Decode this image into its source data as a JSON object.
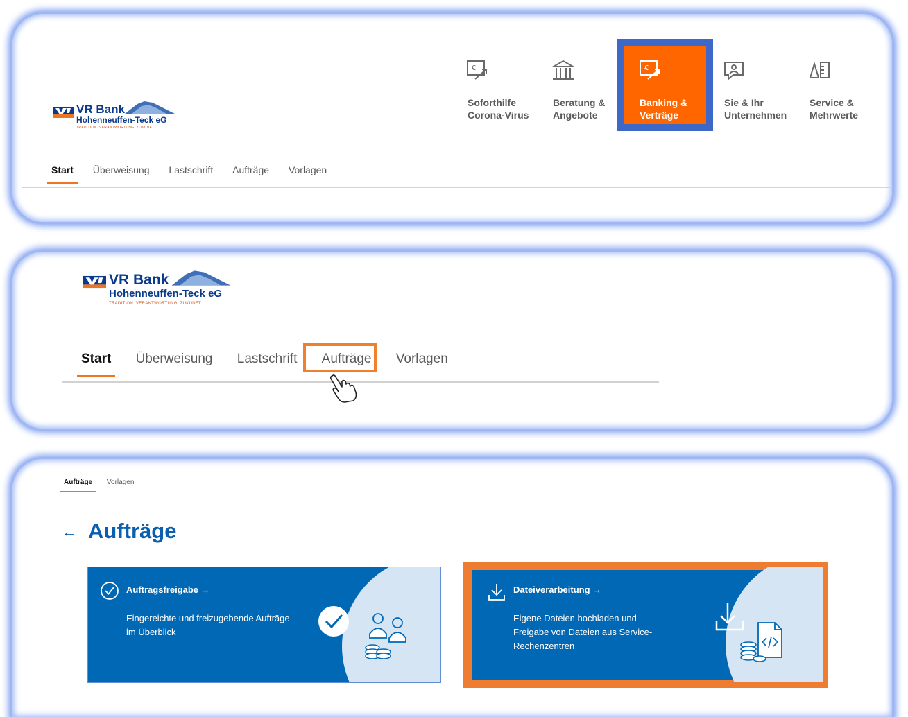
{
  "bank": {
    "name": "VR Bank",
    "subname": "Hohenneuffen-Teck eG",
    "tagline": "TRADITION. VERANTWORTUNG. ZUKUNFT."
  },
  "megamenu": [
    {
      "label": "Soforthilfe Corona-Virus",
      "icon": "euro-transfer-icon"
    },
    {
      "label": "Beratung & Angebote",
      "icon": "bank-building-icon"
    },
    {
      "label": "Banking & Verträge",
      "icon": "euro-transfer-icon",
      "active": true
    },
    {
      "label": "Sie & Ihr Unternehmen",
      "icon": "speech-person-icon"
    },
    {
      "label": "Service & Mehrwerte",
      "icon": "service-icon"
    }
  ],
  "subnav": {
    "start": "Start",
    "ueberweisung": "Überweisung",
    "lastschrift": "Lastschrift",
    "auftraege": "Aufträge",
    "vorlagen": "Vorlagen"
  },
  "page": {
    "back": "←",
    "title": "Aufträge"
  },
  "cards": [
    {
      "title": "Auftragsfreigabe →",
      "text": "Eingereichte und freizugebende Aufträge im Überblick",
      "icon": "check-circle-icon"
    },
    {
      "title": "Dateiverarbeitung →",
      "text": "Eigene Dateien hochladen und Freigabe von Dateien aus Service-Rechenzentren",
      "icon": "download-icon"
    }
  ],
  "colors": {
    "accent_orange": "#ff6600",
    "brand_blue": "#0068b4",
    "highlight_blue": "#3d68c8",
    "highlight_orange": "#ee7d32"
  }
}
